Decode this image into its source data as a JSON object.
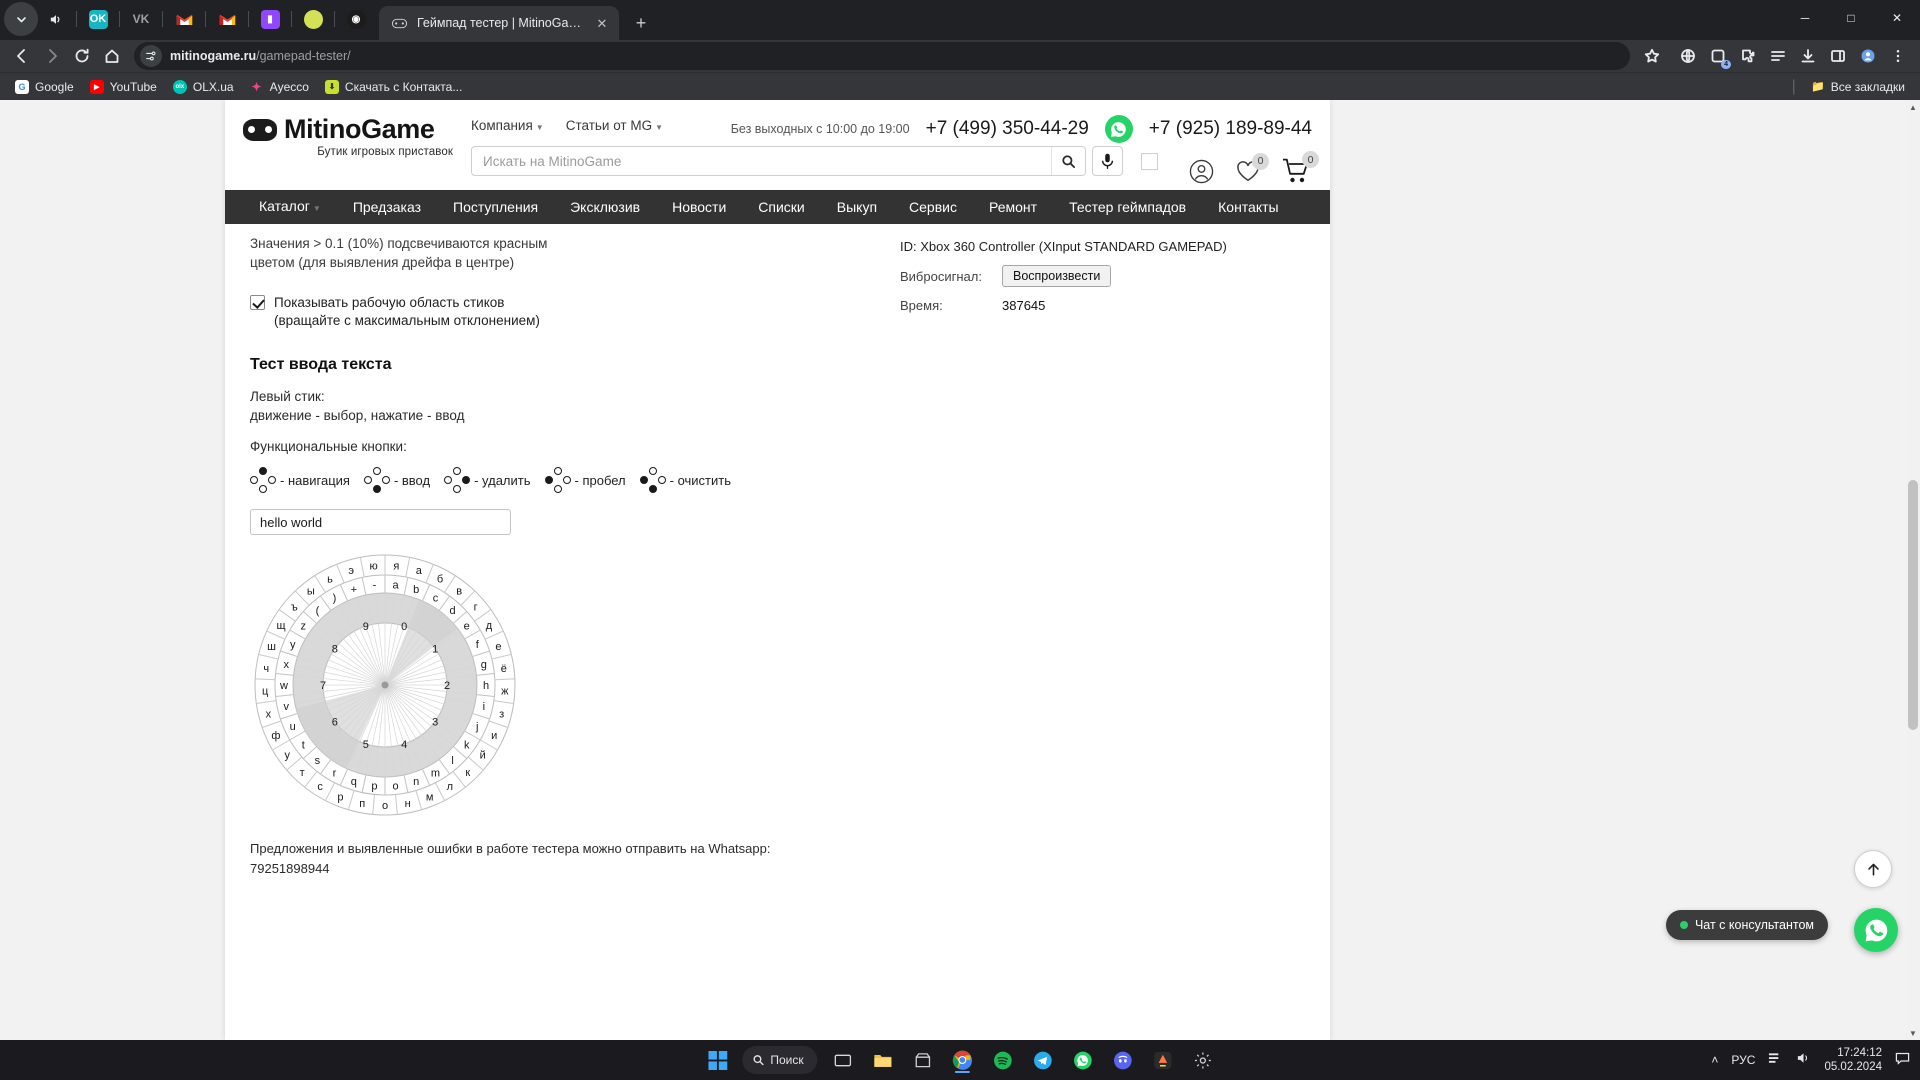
{
  "browser": {
    "tab_icons": [
      {
        "name": "chevron-down-icon",
        "glyph": "∨",
        "color": "#4a4d52"
      },
      {
        "name": "speaker-icon",
        "glyph": "🔊",
        "color": "transparent"
      },
      {
        "name": "odnoklassniki-icon",
        "glyph": "OK",
        "color": "#18b6c4"
      },
      {
        "name": "vk-icon",
        "glyph": "VK",
        "color": "transparent"
      },
      {
        "name": "gmail-icon-1",
        "glyph": "M",
        "color": "transparent"
      },
      {
        "name": "gmail-icon-2",
        "glyph": "M",
        "color": "transparent"
      },
      {
        "name": "twitch-icon",
        "glyph": "■",
        "color": "#9146ff"
      },
      {
        "name": "tennis-ball-icon",
        "glyph": "●",
        "color": "#d4e157"
      },
      {
        "name": "reddit-icon",
        "glyph": "◉",
        "color": "#1a1a1a"
      }
    ],
    "active_tab": {
      "title": "Геймпад тестер | MitinoGame",
      "favicon_name": "gamepad-favicon",
      "close_glyph": "✕"
    },
    "new_tab_glyph": "+",
    "window_controls": {
      "minimize": "─",
      "maximize": "□",
      "close": "✕"
    },
    "omnibox": {
      "url_domain": "mitinogame.ru",
      "url_path": "/gamepad-tester/",
      "lock_icon": "site-settings-icon",
      "star_icon": "☆"
    },
    "toolbar_right_icons": [
      {
        "name": "globe-icon",
        "glyph": "◌"
      },
      {
        "name": "extension-count-icon",
        "glyph": "▣",
        "badge": "4"
      },
      {
        "name": "extensions-puzzle-icon",
        "glyph": "⧉"
      },
      {
        "name": "reading-list-icon",
        "glyph": "☷"
      },
      {
        "name": "downloads-icon",
        "glyph": "⬇"
      },
      {
        "name": "side-panel-icon",
        "glyph": "▧"
      },
      {
        "name": "profile-avatar-icon",
        "glyph": "●"
      },
      {
        "name": "chrome-menu-icon",
        "glyph": "⋮"
      }
    ],
    "bookmarks": [
      {
        "label": "Google",
        "icon_letter": "G",
        "color": "#ffffff"
      },
      {
        "label": "YouTube",
        "icon_letter": "▶",
        "color": "#ff0000"
      },
      {
        "label": "OLX.ua",
        "icon_letter": "olx",
        "color": "#00c4b3"
      },
      {
        "label": "Аyecco",
        "icon_letter": "A",
        "color": "#e8498a"
      },
      {
        "label": "Скачать с Контакта...",
        "icon_letter": "⬇",
        "color": "#c6e02b"
      }
    ],
    "bookmarks_all": {
      "label": "Все закладки",
      "icon": "folder-icon"
    }
  },
  "site": {
    "logo": {
      "name": "MitinoGame",
      "tagline": "Бутик игровых приставок",
      "icon": "gamepad-logo-icon"
    },
    "header_menu": [
      {
        "label": "Компания",
        "has_caret": true
      },
      {
        "label": "Статьи от MG",
        "has_caret": true
      }
    ],
    "search": {
      "placeholder": "Искать на MitinoGame",
      "value": "",
      "button_icon": "search-icon",
      "mic_icon": "microphone-icon"
    },
    "worktime": "Без выходных с 10:00 до 19:00",
    "phone_primary": "+7 (499) 350-44-29",
    "phone_secondary": "+7 (925) 189-89-44",
    "whatsapp_icon": "whatsapp-icon",
    "account_icon": "user-account-icon",
    "favorites": {
      "icon": "heart-icon",
      "count": "0"
    },
    "cart": {
      "icon": "cart-icon",
      "count": "0"
    },
    "nav": [
      {
        "label": "Каталог",
        "has_caret": true
      },
      {
        "label": "Предзаказ",
        "has_caret": false
      },
      {
        "label": "Поступления",
        "has_caret": false
      },
      {
        "label": "Эксклюзив",
        "has_caret": false
      },
      {
        "label": "Новости",
        "has_caret": false
      },
      {
        "label": "Списки",
        "has_caret": false
      },
      {
        "label": "Выкуп",
        "has_caret": false
      },
      {
        "label": "Сервис",
        "has_caret": false
      },
      {
        "label": "Ремонт",
        "has_caret": false
      },
      {
        "label": "Тестер геймпадов",
        "has_caret": false
      },
      {
        "label": "Контакты",
        "has_caret": false
      }
    ]
  },
  "tester": {
    "hint_line1": "Значения > 0.1 (10%) подсвечиваются красным",
    "hint_line2": "цветом (для выявления дрейфа в центре)",
    "checkbox": {
      "checked": true,
      "label_line1": "Показывать рабочую область стиков",
      "label_line2": "(вращайте с максимальным отклонением)"
    },
    "section_title": "Тест ввода текста",
    "stick_label": "Левый стик:",
    "stick_desc": "движение - выбор, нажатие - ввод",
    "func_title": "Функциональные кнопки:",
    "func_buttons": [
      {
        "label": "- навигация",
        "active": "up"
      },
      {
        "label": "- ввод",
        "active": "down"
      },
      {
        "label": "- удалить",
        "active": "right"
      },
      {
        "label": "- пробел",
        "active": "left"
      },
      {
        "label": "- очистить",
        "active": "left-down"
      }
    ],
    "text_value": "hello world",
    "text_placeholder": "",
    "footer_line1": "Предложения и выявленные ошибки в работе тестера можно отправить на Whatsapp:",
    "footer_line2": "79251898944",
    "wheel": {
      "outer_ring": [
        "я",
        "а",
        "б",
        "в",
        "г",
        "д",
        "е",
        "ё",
        "ж",
        "з",
        "и",
        "й",
        "к",
        "л",
        "м",
        "н",
        "о",
        "п",
        "р",
        "с",
        "т",
        "у",
        "ф",
        "х",
        "ц",
        "ч",
        "ш",
        "щ",
        "ъ",
        "ы",
        "ь",
        "э",
        "ю"
      ],
      "inner_ring": [
        "а",
        "b",
        "c",
        "d",
        "e",
        "f",
        "g",
        "h",
        "i",
        "j",
        "k",
        "l",
        "m",
        "n",
        "o",
        "p",
        "q",
        "r",
        "s",
        "t",
        "u",
        "v",
        "w",
        "x",
        "y",
        "z",
        "(",
        ")",
        "+",
        "-"
      ],
      "digits": [
        "0",
        "1",
        "2",
        "3",
        "4",
        "5",
        "6",
        "7",
        "8",
        "9"
      ]
    }
  },
  "gamepad_panel": {
    "id_label": "ID: Xbox 360 Controller (XInput STANDARD GAMEPAD)",
    "vibration_label": "Вибросигнал:",
    "vibration_button": "Воспроизвести",
    "time_label": "Время:",
    "time_value": "387645"
  },
  "widgets": {
    "to_top_icon": "arrow-up-icon",
    "chat_label": "Чат с консультантом",
    "whatsapp_fab_icon": "whatsapp-icon"
  },
  "taskbar": {
    "start_icon": "windows-start-icon",
    "search_label": "Поиск",
    "search_icon": "search-icon",
    "apps": [
      {
        "name": "task-view-icon",
        "glyph": "⬚",
        "color": "#d8d8d8"
      },
      {
        "name": "file-explorer-icon",
        "glyph": "📁",
        "color": "#f0c14b"
      },
      {
        "name": "store-icon",
        "glyph": "⊞",
        "color": "#cfcfcf"
      },
      {
        "name": "chrome-icon",
        "glyph": "●",
        "color": "#4285f4",
        "running": true
      },
      {
        "name": "spotify-icon",
        "glyph": "♫",
        "color": "#1db954"
      },
      {
        "name": "telegram-icon",
        "glyph": "➤",
        "color": "#2aabee"
      },
      {
        "name": "whatsapp-icon",
        "glyph": "✆",
        "color": "#25d366"
      },
      {
        "name": "discord-icon",
        "glyph": "◑",
        "color": "#5865f2"
      },
      {
        "name": "app-orange-icon",
        "glyph": "◆",
        "color": "#ff6a3d"
      },
      {
        "name": "settings-icon",
        "glyph": "⚙",
        "color": "#cfcfcf"
      }
    ],
    "tray": {
      "chevron": "˄",
      "language": "РУС",
      "network_icon": "☰",
      "volume_icon": "🔊",
      "time": "17:24:12",
      "date": "05.02.2024",
      "notification_icon": "💬"
    }
  }
}
